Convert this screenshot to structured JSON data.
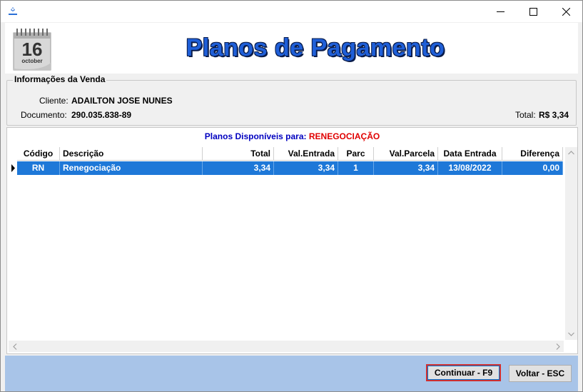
{
  "window": {
    "minimize_icon": "minimize-icon",
    "maximize_icon": "maximize-icon",
    "close_icon": "close-icon"
  },
  "header": {
    "title": "Planos de Pagamento",
    "calendar": {
      "day": "16",
      "month": "october"
    }
  },
  "sale_info": {
    "legend": "Informações da Venda",
    "client_label": "Cliente:",
    "client_value": "ADAILTON JOSE NUNES",
    "document_label": "Documento:",
    "document_value": "290.035.838-89",
    "total_label": "Total:",
    "total_value": "R$ 3,34"
  },
  "plans": {
    "title_label": "Planos Disponíveis para:",
    "title_type": "RENEGOCIAÇÃO",
    "columns": [
      "Código",
      "Descrição",
      "Total",
      "Val.Entrada",
      "Parc",
      "Val.Parcela",
      "Data Entrada",
      "Diferença"
    ],
    "rows": [
      [
        "RN",
        "Renegociação",
        "3,34",
        "3,34",
        "1",
        "3,34",
        "13/08/2022",
        "0,00"
      ]
    ]
  },
  "footer": {
    "continue_label": "Continuar - F9",
    "back_label": "Voltar - ESC"
  },
  "colors": {
    "title_blue": "#1f5fd8",
    "selected_row": "#1e78d8",
    "footer_bg": "#a8c4e8",
    "type_red": "#e00000",
    "label_blue": "#0000c0"
  }
}
